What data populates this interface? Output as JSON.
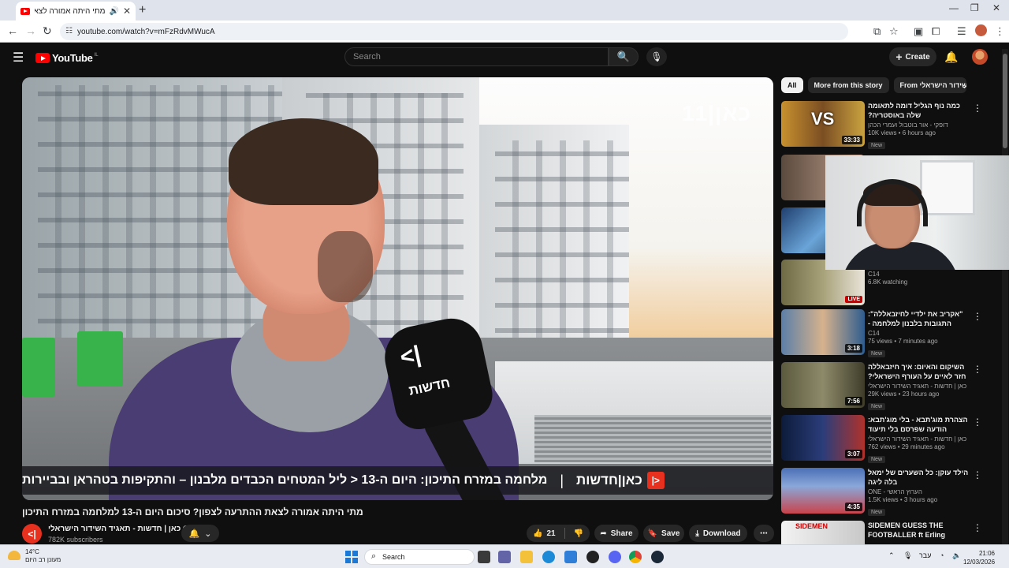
{
  "browser": {
    "tab_title": "מתי היתה אמורה לצאת הה",
    "url": "youtube.com/watch?v=mFzRdvMWucA"
  },
  "youtube": {
    "logo_text": "YouTube",
    "logo_country": "IL",
    "search_placeholder": "Search",
    "create_label": "Create"
  },
  "video": {
    "watermark": "כאן|11",
    "mic_text": "חדשות",
    "lower_third_brand": "כאן|חדשות",
    "lower_third_headline": "מלחמה במזרח התיכון: היום ה-13 < ליל המטחים הכבדים מלבנון – והתקיפות בטהראן ובביירות",
    "title": "מתי היתה אמורה לצאת ההתרעה לצפון? סיכום היום ה-13 למלחמה במזרח התיכון",
    "channel_name": "כאן | חדשות - תאגיד השידור הישראלי",
    "subscribers": "782K subscribers",
    "likes": "21",
    "share_label": "Share",
    "save_label": "Save",
    "download_label": "Download"
  },
  "sidebar": {
    "chips": [
      "All",
      "More from this story",
      "From השידור הישראלי"
    ],
    "recs": [
      {
        "title": "כמה נוף הגליל דומה לתאומה שלה באוסטריה?",
        "channel": "דופקי - אור בוטבול ועמרי הכהן",
        "stats": "10K views • 6 hours ago",
        "badge": "New",
        "duration": "33:33"
      },
      {
        "title": "",
        "channel": "C14",
        "stats": "6.8K watching",
        "badge": "",
        "duration": "LIVE"
      },
      {
        "title": "\"אקריב את ילדיי לחיזבאללה\": התגובות בלבנון למלחמה - אחיקם ...",
        "channel": "C14",
        "stats": "75 views • 7 minutes ago",
        "badge": "New",
        "duration": "3:18"
      },
      {
        "title": "השיקום והאיום: איך חיזבאללה חזר לאיים על העורף הישראלי?",
        "channel": "כאן | חדשות - תאגיד השידור הישראלי",
        "stats": "29K views • 23 hours ago",
        "badge": "New",
        "duration": "7:56"
      },
      {
        "title": "הצהרת מוג'תבא - בלי מוג'תבא: הודעה שפרסם בלי תיעוד והשמועות ...",
        "channel": "כאן | חדשות - תאגיד השידור הישראלי",
        "stats": "762 views • 29 minutes ago",
        "badge": "New",
        "duration": "3:07"
      },
      {
        "title": "הילד עוקן: כל השערים של ימאל בלה ליגה",
        "channel": "ONE - הערוץ הראשי",
        "stats": "1.5K views • 3 hours ago",
        "badge": "New",
        "duration": "4:35"
      },
      {
        "title": "SIDEMEN GUESS THE FOOTBALLER ft Erling Haaland",
        "channel": "",
        "stats": "",
        "badge": "",
        "duration": ""
      }
    ]
  },
  "taskbar": {
    "temp": "14°C",
    "weather_desc": "מעונן רב היום",
    "search_label": "Search",
    "lang": "עבר",
    "time": "21:06",
    "date": "12/03/2026"
  },
  "colors": {
    "yt_red": "#ff0000",
    "kan_red": "#e8301f",
    "bg": "#0f0f0f"
  }
}
